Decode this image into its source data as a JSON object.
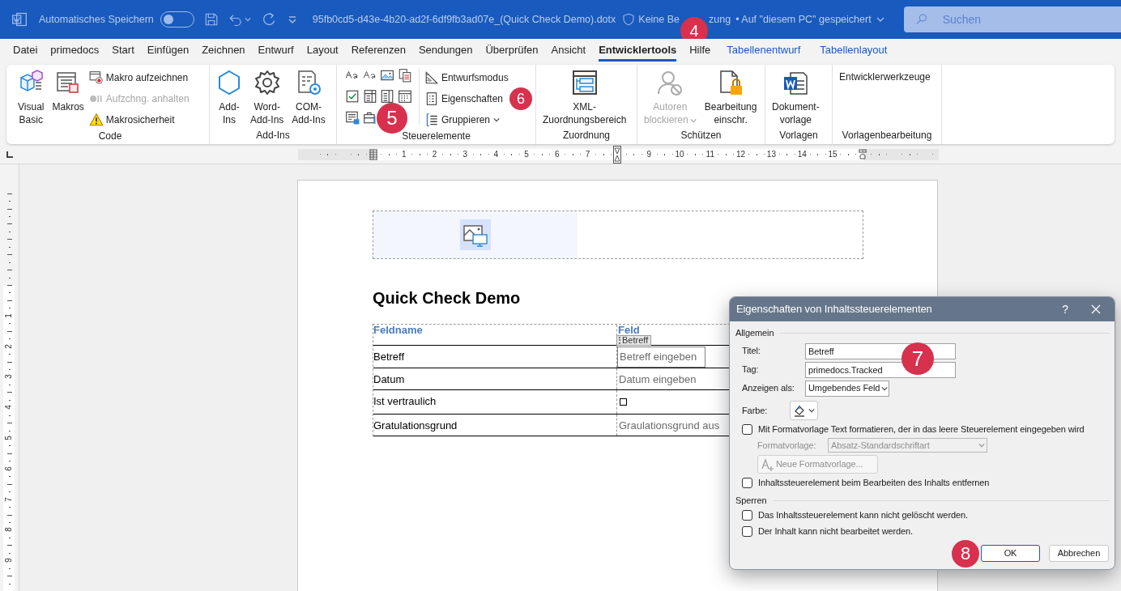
{
  "titlebar": {
    "autosave_label": "Automatisches Speichern",
    "autosave_on": false,
    "filename": "95fb0cd5-d43e-4b20-ad2f-6df9fb3ad07e_(Quick Check Demo).dotx",
    "label_start": "Keine Be",
    "label_end": "zung",
    "location": "• Auf \"diesem PC\" gespeichert",
    "search_placeholder": "Suchen"
  },
  "tabs": [
    {
      "label": "Datei",
      "selected": false,
      "kind": "normal"
    },
    {
      "label": "primedocs",
      "selected": false,
      "kind": "normal"
    },
    {
      "label": "Start",
      "selected": false,
      "kind": "normal"
    },
    {
      "label": "Einfügen",
      "selected": false,
      "kind": "normal"
    },
    {
      "label": "Zeichnen",
      "selected": false,
      "kind": "normal"
    },
    {
      "label": "Entwurf",
      "selected": false,
      "kind": "normal"
    },
    {
      "label": "Layout",
      "selected": false,
      "kind": "normal"
    },
    {
      "label": "Referenzen",
      "selected": false,
      "kind": "normal"
    },
    {
      "label": "Sendungen",
      "selected": false,
      "kind": "normal"
    },
    {
      "label": "Überprüfen",
      "selected": false,
      "kind": "normal"
    },
    {
      "label": "Ansicht",
      "selected": false,
      "kind": "normal"
    },
    {
      "label": "Entwicklertools",
      "selected": true,
      "kind": "normal"
    },
    {
      "label": "Hilfe",
      "selected": false,
      "kind": "normal"
    },
    {
      "label": "Tabellenentwurf",
      "selected": false,
      "kind": "contextual"
    },
    {
      "label": "Tabellenlayout",
      "selected": false,
      "kind": "contextual"
    }
  ],
  "ribbon": [
    {
      "label": "Code",
      "items": [
        {
          "kind": "large",
          "label": "Visual\nBasic",
          "disabled": false,
          "dropdown": false
        },
        {
          "kind": "large",
          "label": "Makros",
          "disabled": false,
          "dropdown": false
        },
        {
          "kind": "small",
          "label": "Makro aufzeichnen",
          "disabled": false,
          "dropdown": false
        },
        {
          "kind": "small",
          "label": "Aufzchng. anhalten",
          "disabled": true,
          "dropdown": false
        },
        {
          "kind": "small",
          "label": "Makrosicherheit",
          "disabled": false,
          "dropdown": false
        }
      ]
    },
    {
      "label": "Add-Ins",
      "items": [
        {
          "kind": "large",
          "label": "Add-\nIns",
          "disabled": false,
          "dropdown": false
        },
        {
          "kind": "large",
          "label": "Word-\nAdd-Ins",
          "disabled": false,
          "dropdown": false
        },
        {
          "kind": "large",
          "label": "COM-\nAdd-Ins",
          "disabled": false,
          "dropdown": false
        }
      ]
    },
    {
      "label": "Steuerelemente",
      "items": [
        {
          "kind": "gallery"
        },
        {
          "kind": "small",
          "label": "Entwurfsmodus",
          "disabled": false,
          "dropdown": false
        },
        {
          "kind": "small",
          "label": "Eigenschaften",
          "disabled": false,
          "dropdown": false
        },
        {
          "kind": "small",
          "label": "Gruppieren",
          "disabled": false,
          "dropdown": true
        }
      ]
    },
    {
      "label": "Zuordnung",
      "items": [
        {
          "kind": "large",
          "label": "XML-\nZuordnungsbereich",
          "disabled": false,
          "dropdown": false
        }
      ]
    },
    {
      "label": "Schützen",
      "items": [
        {
          "kind": "large",
          "label": "Autoren\nblockieren",
          "disabled": true,
          "dropdown": true
        },
        {
          "kind": "large",
          "label": "Bearbeitung\neinschr.",
          "disabled": false,
          "dropdown": false
        }
      ]
    },
    {
      "label": "Vorlagen",
      "items": [
        {
          "kind": "large",
          "label": "Dokument-\nvorlage",
          "disabled": false,
          "dropdown": false
        }
      ]
    },
    {
      "label": "Vorlagenbearbeitung",
      "items": [
        {
          "kind": "text",
          "label": "Entwicklerwerkzeuge",
          "disabled": false,
          "dropdown": false
        }
      ]
    }
  ],
  "ruler": [
    {
      "label": "1"
    },
    {
      "label": "2"
    },
    {
      "label": "3"
    },
    {
      "label": "4"
    },
    {
      "label": "5"
    },
    {
      "label": "6"
    },
    {
      "label": "7"
    },
    {
      "label": "9"
    },
    {
      "label": "10"
    },
    {
      "label": "11"
    },
    {
      "label": "12"
    },
    {
      "label": "13"
    },
    {
      "label": "14"
    },
    {
      "label": "15"
    }
  ],
  "vertical_ruler": [
    {
      "label": "1"
    },
    {
      "label": "2"
    },
    {
      "label": "3"
    },
    {
      "label": "4"
    },
    {
      "label": "5"
    },
    {
      "label": "6"
    },
    {
      "label": "7"
    },
    {
      "label": "8"
    },
    {
      "label": "9"
    }
  ],
  "document": {
    "heading": "Quick Check Demo",
    "table": {
      "columns": [
        "Feldname",
        "Feld"
      ],
      "rows": [
        {
          "name": "Betreff",
          "kind": "text",
          "value": "Betreff eingeben",
          "selected": true,
          "tag": "Betreff"
        },
        {
          "name": "Datum",
          "kind": "text",
          "value": "Datum eingeben",
          "selected": false
        },
        {
          "name": "Ist vertraulich",
          "kind": "checkbox",
          "checked": false,
          "selected": false
        },
        {
          "name": "Gratulationsgrund",
          "kind": "text",
          "value": "Graulationsgrund aus",
          "selected": false
        }
      ]
    }
  },
  "dialog": {
    "title": "Eigenschaften von Inhaltssteuerelementen",
    "help": "?",
    "general_heading": "Allgemein",
    "fields": [
      {
        "kind": "text",
        "label": "Titel:",
        "value": "Betreff"
      },
      {
        "kind": "text",
        "label": "Tag:",
        "value": "primedocs.Tracked"
      },
      {
        "kind": "select",
        "label": "Anzeigen als:",
        "value": "Umgebendes Feld"
      },
      {
        "kind": "color",
        "label": "Farbe:"
      }
    ],
    "format_option": {
      "label": "Mit Formatvorlage Text formatieren, der in das leere Steuerelement eingegeben wird",
      "checked": false
    },
    "style": {
      "label": "Formatvorlage:",
      "value": "Absatz-Standardschriftart",
      "disabled": true
    },
    "new_style_button": {
      "label": "Neue Formatvorlage...",
      "disabled": true
    },
    "remove_option": {
      "label": "Inhaltssteuerelement beim Bearbeiten des Inhalts entfernen",
      "checked": false
    },
    "lock_heading": "Sperren",
    "lock_options": [
      {
        "label": "Das Inhaltssteuerelement kann nicht gelöscht werden.",
        "checked": false
      },
      {
        "label": "Der Inhalt kann nicht bearbeitet werden.",
        "checked": false
      }
    ],
    "buttons": [
      {
        "label": "OK",
        "default": true
      },
      {
        "label": "Abbrechen",
        "default": false
      }
    ]
  },
  "callouts": [
    {
      "label": "4"
    },
    {
      "label": "5"
    },
    {
      "label": "6"
    },
    {
      "label": "7"
    },
    {
      "label": "8"
    }
  ]
}
